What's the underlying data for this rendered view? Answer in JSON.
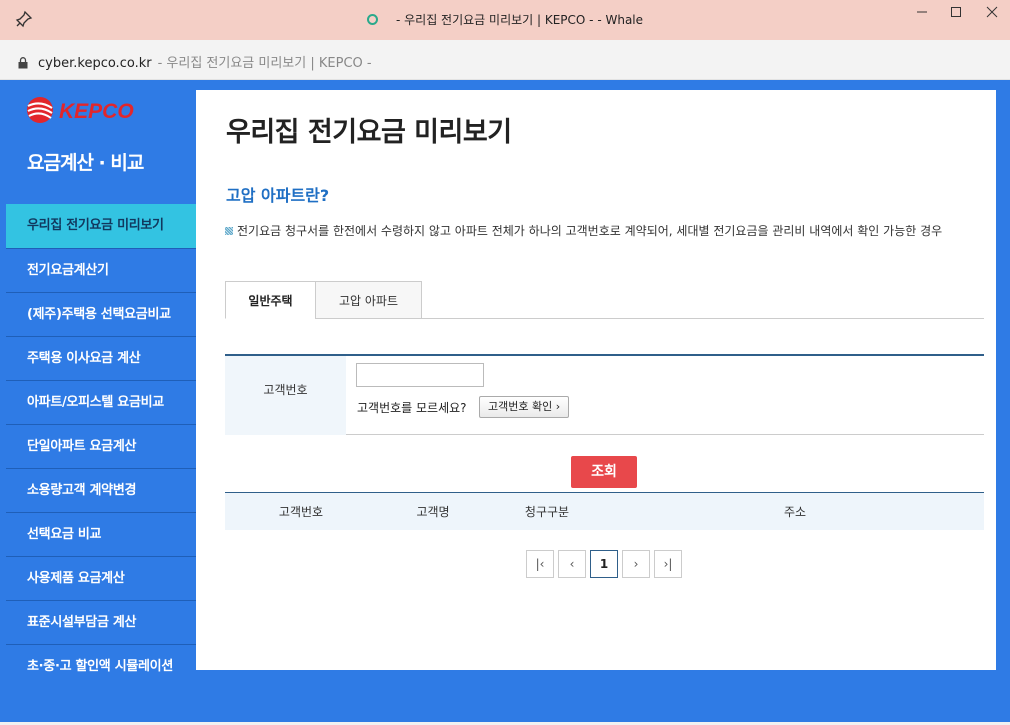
{
  "browser": {
    "window_title": "- 우리집 전기요금 미리보기 | KEPCO - - Whale",
    "url_domain": "cyber.kepco.co.kr",
    "url_title": "- 우리집 전기요금 미리보기 | KEPCO -"
  },
  "sidebar": {
    "logo_text": "KEPCO",
    "section_title": "요금계산 · 비교",
    "items": [
      {
        "label": "우리집 전기요금 미리보기",
        "active": true
      },
      {
        "label": "전기요금계산기"
      },
      {
        "label": "(제주)주택용 선택요금비교"
      },
      {
        "label": "주택용 이사요금 계산"
      },
      {
        "label": "아파트/오피스텔 요금비교"
      },
      {
        "label": "단일아파트 요금계산"
      },
      {
        "label": "소용량고객 계약변경"
      },
      {
        "label": "선택요금 비교"
      },
      {
        "label": "사용제품 요금계산"
      },
      {
        "label": "표준시설부담금 계산"
      },
      {
        "label": "초·중·고 할인액 시뮬레이션"
      }
    ]
  },
  "main": {
    "page_title": "우리집 전기요금 미리보기",
    "subheading": "고압 아파트란?",
    "description": "전기요금 청구서를 한전에서 수령하지 않고 아파트 전체가 하나의 고객번호로 계약되어, 세대별 전기요금을 관리비 내역에서 확인 가능한 경우",
    "tabs": [
      {
        "label": "일반주택",
        "active": true
      },
      {
        "label": "고압 아파트"
      }
    ],
    "form": {
      "label": "고객번호",
      "input_value": "",
      "help_text": "고객번호를 모르세요?",
      "help_button": "고객번호 확인 ›"
    },
    "search_button": "조회",
    "table": {
      "columns": [
        "고객번호",
        "고객명",
        "청구구분",
        "주소"
      ]
    },
    "pagination": {
      "first": "|‹",
      "prev": "‹",
      "current": "1",
      "next": "›",
      "last": "›|"
    }
  }
}
